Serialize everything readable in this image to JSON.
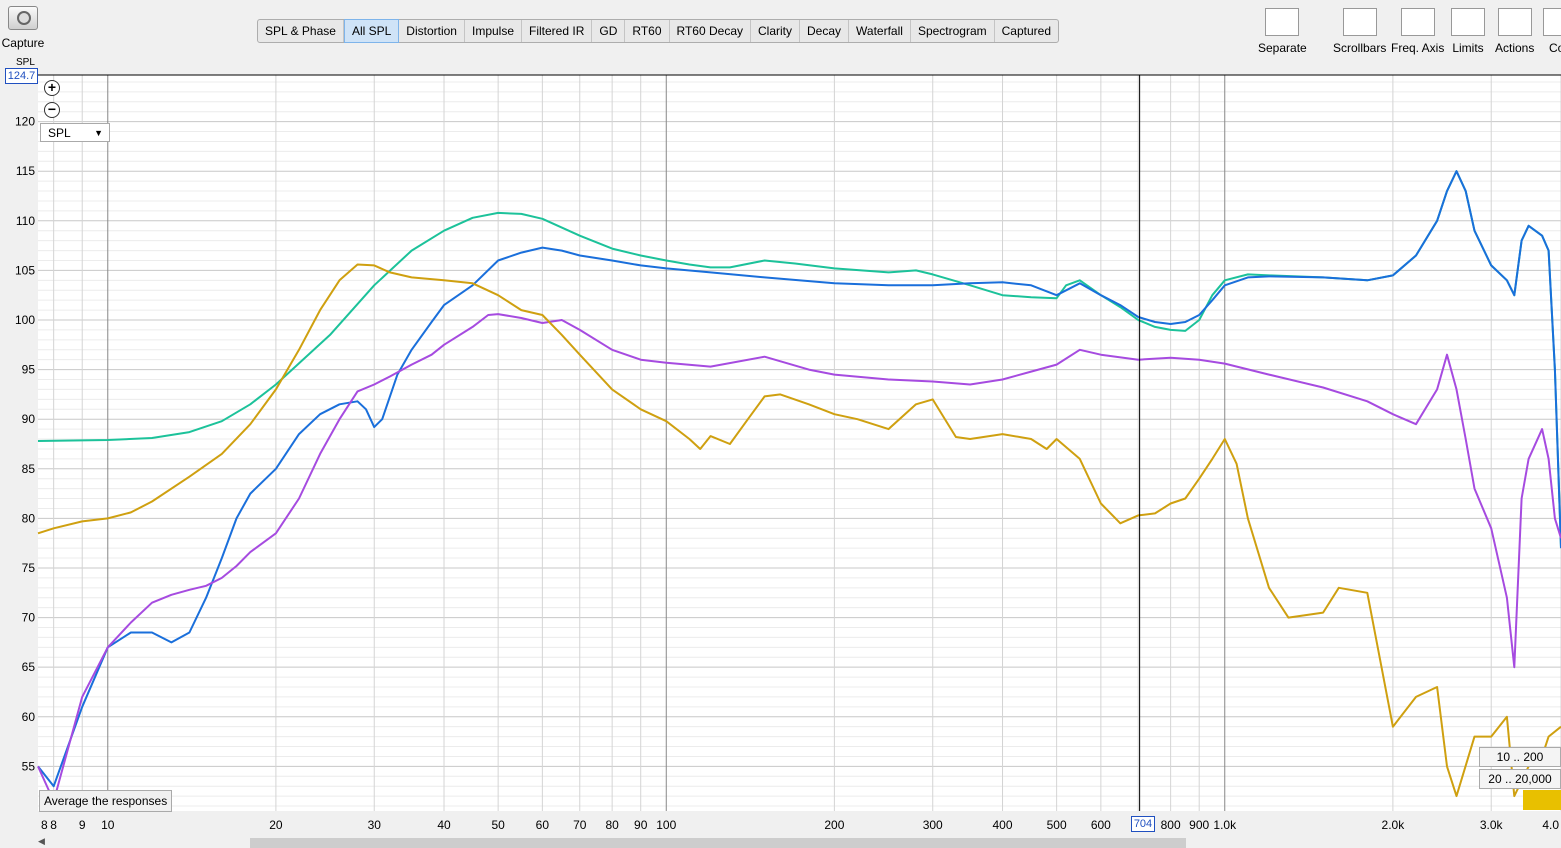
{
  "toolbar": {
    "capture_label": "Capture",
    "tabs": [
      "SPL & Phase",
      "All SPL",
      "Distortion",
      "Impulse",
      "Filtered IR",
      "GD",
      "RT60",
      "RT60 Decay",
      "Clarity",
      "Decay",
      "Waterfall",
      "Spectrogram",
      "Captured"
    ],
    "active_tab": "All SPL",
    "right_tools": [
      "Separate",
      "Scrollbars",
      "Freq. Axis",
      "Limits",
      "Actions",
      "Con"
    ]
  },
  "plot": {
    "axis_title": "SPL",
    "max_readout": "124.7",
    "cursor_freq": "704",
    "dropdown_value": "SPL",
    "avg_button": "Average the responses",
    "range_buttons": [
      "10 .. 200",
      "20 .. 20,000"
    ]
  },
  "chart_data": {
    "type": "line",
    "xscale": "log",
    "xlim": [
      7.5,
      4000
    ],
    "ylim": [
      50.5,
      124.7
    ],
    "x_ticks": [
      "8",
      "8",
      "9",
      "10",
      "20",
      "30",
      "40",
      "50",
      "60",
      "70",
      "80",
      "90",
      "100",
      "200",
      "300",
      "400",
      "500",
      "600",
      "704",
      "800",
      "900",
      "1.0k",
      "2.0k",
      "3.0k",
      "4.0"
    ],
    "y_ticks": [
      "55",
      "60",
      "65",
      "70",
      "75",
      "80",
      "85",
      "90",
      "95",
      "100",
      "105",
      "110",
      "115",
      "120"
    ],
    "cursor_x": 704,
    "series": [
      {
        "color": "#1cc29a",
        "points": [
          [
            7.5,
            87.8
          ],
          [
            10,
            87.9
          ],
          [
            12,
            88.1
          ],
          [
            14,
            88.7
          ],
          [
            16,
            89.8
          ],
          [
            18,
            91.5
          ],
          [
            20,
            93.5
          ],
          [
            25,
            98.5
          ],
          [
            30,
            103.5
          ],
          [
            35,
            107
          ],
          [
            40,
            109
          ],
          [
            45,
            110.3
          ],
          [
            50,
            110.8
          ],
          [
            55,
            110.7
          ],
          [
            60,
            110.2
          ],
          [
            70,
            108.5
          ],
          [
            80,
            107.2
          ],
          [
            90,
            106.5
          ],
          [
            100,
            106
          ],
          [
            110,
            105.6
          ],
          [
            120,
            105.3
          ],
          [
            130,
            105.3
          ],
          [
            150,
            106
          ],
          [
            170,
            105.7
          ],
          [
            200,
            105.2
          ],
          [
            250,
            104.8
          ],
          [
            280,
            105
          ],
          [
            300,
            104.6
          ],
          [
            350,
            103.5
          ],
          [
            400,
            102.5
          ],
          [
            450,
            102.3
          ],
          [
            500,
            102.2
          ],
          [
            520,
            103.5
          ],
          [
            550,
            104
          ],
          [
            600,
            102.5
          ],
          [
            650,
            101.3
          ],
          [
            700,
            100
          ],
          [
            750,
            99.3
          ],
          [
            800,
            99
          ],
          [
            850,
            98.9
          ],
          [
            900,
            100
          ],
          [
            950,
            102.5
          ],
          [
            1000,
            104
          ],
          [
            1100,
            104.6
          ],
          [
            1200,
            104.5
          ],
          [
            1500,
            104.3
          ],
          [
            1800,
            104
          ],
          [
            2000,
            104.5
          ],
          [
            2200,
            106.5
          ],
          [
            2400,
            110
          ],
          [
            2500,
            113
          ],
          [
            2600,
            115
          ],
          [
            2700,
            113
          ],
          [
            2800,
            109
          ],
          [
            3000,
            105.5
          ],
          [
            3200,
            104
          ],
          [
            3300,
            102.5
          ],
          [
            3400,
            108
          ],
          [
            3500,
            109.5
          ],
          [
            3700,
            108.5
          ],
          [
            3800,
            107
          ],
          [
            3900,
            95
          ],
          [
            4000,
            77
          ]
        ]
      },
      {
        "color": "#1a6fdb",
        "points": [
          [
            7.5,
            55
          ],
          [
            8,
            53
          ],
          [
            9,
            61
          ],
          [
            10,
            67
          ],
          [
            11,
            68.5
          ],
          [
            12,
            68.5
          ],
          [
            13,
            67.5
          ],
          [
            14,
            68.5
          ],
          [
            15,
            72
          ],
          [
            16,
            76
          ],
          [
            17,
            80
          ],
          [
            18,
            82.5
          ],
          [
            20,
            85
          ],
          [
            22,
            88.5
          ],
          [
            24,
            90.5
          ],
          [
            26,
            91.5
          ],
          [
            28,
            91.8
          ],
          [
            29,
            91
          ],
          [
            30,
            89.2
          ],
          [
            31,
            90
          ],
          [
            33,
            94.5
          ],
          [
            35,
            97
          ],
          [
            38,
            99.8
          ],
          [
            40,
            101.5
          ],
          [
            45,
            103.5
          ],
          [
            50,
            106
          ],
          [
            55,
            106.8
          ],
          [
            60,
            107.3
          ],
          [
            65,
            107
          ],
          [
            70,
            106.5
          ],
          [
            80,
            106
          ],
          [
            90,
            105.5
          ],
          [
            100,
            105.2
          ],
          [
            120,
            104.8
          ],
          [
            150,
            104.3
          ],
          [
            200,
            103.7
          ],
          [
            250,
            103.5
          ],
          [
            300,
            103.5
          ],
          [
            350,
            103.7
          ],
          [
            400,
            103.8
          ],
          [
            450,
            103.5
          ],
          [
            500,
            102.5
          ],
          [
            550,
            103.7
          ],
          [
            600,
            102.5
          ],
          [
            650,
            101.5
          ],
          [
            700,
            100.3
          ],
          [
            750,
            99.8
          ],
          [
            800,
            99.6
          ],
          [
            850,
            99.8
          ],
          [
            900,
            100.5
          ],
          [
            950,
            102
          ],
          [
            1000,
            103.5
          ],
          [
            1100,
            104.3
          ],
          [
            1200,
            104.4
          ],
          [
            1500,
            104.3
          ],
          [
            1800,
            104
          ],
          [
            2000,
            104.5
          ],
          [
            2200,
            106.5
          ],
          [
            2400,
            110
          ],
          [
            2500,
            113
          ],
          [
            2600,
            115
          ],
          [
            2700,
            113
          ],
          [
            2800,
            109
          ],
          [
            3000,
            105.5
          ],
          [
            3200,
            104
          ],
          [
            3300,
            102.5
          ],
          [
            3400,
            108
          ],
          [
            3500,
            109.5
          ],
          [
            3700,
            108.5
          ],
          [
            3800,
            107
          ],
          [
            3900,
            95
          ],
          [
            4000,
            77
          ]
        ]
      },
      {
        "color": "#a64be0",
        "points": [
          [
            7.5,
            55
          ],
          [
            8,
            51.5
          ],
          [
            9,
            62
          ],
          [
            10,
            67
          ],
          [
            11,
            69.5
          ],
          [
            12,
            71.5
          ],
          [
            13,
            72.3
          ],
          [
            14,
            72.8
          ],
          [
            15,
            73.2
          ],
          [
            16,
            74
          ],
          [
            17,
            75.2
          ],
          [
            18,
            76.6
          ],
          [
            20,
            78.5
          ],
          [
            22,
            82
          ],
          [
            24,
            86.5
          ],
          [
            26,
            90
          ],
          [
            28,
            92.8
          ],
          [
            30,
            93.5
          ],
          [
            32,
            94.3
          ],
          [
            35,
            95.5
          ],
          [
            38,
            96.5
          ],
          [
            40,
            97.5
          ],
          [
            45,
            99.3
          ],
          [
            48,
            100.5
          ],
          [
            50,
            100.6
          ],
          [
            55,
            100.2
          ],
          [
            60,
            99.7
          ],
          [
            65,
            100
          ],
          [
            70,
            99
          ],
          [
            80,
            97
          ],
          [
            90,
            96
          ],
          [
            100,
            95.7
          ],
          [
            120,
            95.3
          ],
          [
            150,
            96.3
          ],
          [
            180,
            95
          ],
          [
            200,
            94.5
          ],
          [
            250,
            94
          ],
          [
            300,
            93.8
          ],
          [
            350,
            93.5
          ],
          [
            400,
            94
          ],
          [
            450,
            94.8
          ],
          [
            500,
            95.5
          ],
          [
            550,
            97
          ],
          [
            600,
            96.5
          ],
          [
            700,
            96
          ],
          [
            800,
            96.2
          ],
          [
            900,
            96
          ],
          [
            1000,
            95.6
          ],
          [
            1200,
            94.5
          ],
          [
            1500,
            93.2
          ],
          [
            1800,
            91.8
          ],
          [
            2000,
            90.5
          ],
          [
            2200,
            89.5
          ],
          [
            2400,
            93
          ],
          [
            2500,
            96.5
          ],
          [
            2600,
            93
          ],
          [
            2700,
            88
          ],
          [
            2800,
            83
          ],
          [
            3000,
            79
          ],
          [
            3200,
            72
          ],
          [
            3300,
            65
          ],
          [
            3400,
            82
          ],
          [
            3500,
            86
          ],
          [
            3700,
            89
          ],
          [
            3800,
            86
          ],
          [
            3900,
            80
          ],
          [
            4000,
            78
          ]
        ]
      },
      {
        "color": "#cfa010",
        "points": [
          [
            7.5,
            78.5
          ],
          [
            8,
            79
          ],
          [
            9,
            79.7
          ],
          [
            10,
            80
          ],
          [
            11,
            80.6
          ],
          [
            12,
            81.7
          ],
          [
            14,
            84.2
          ],
          [
            16,
            86.5
          ],
          [
            18,
            89.5
          ],
          [
            20,
            93
          ],
          [
            22,
            97
          ],
          [
            24,
            101
          ],
          [
            26,
            104
          ],
          [
            28,
            105.6
          ],
          [
            30,
            105.5
          ],
          [
            32,
            104.8
          ],
          [
            35,
            104.3
          ],
          [
            40,
            104
          ],
          [
            45,
            103.7
          ],
          [
            50,
            102.5
          ],
          [
            55,
            101
          ],
          [
            60,
            100.5
          ],
          [
            65,
            98.5
          ],
          [
            70,
            96.5
          ],
          [
            80,
            93
          ],
          [
            90,
            91
          ],
          [
            100,
            89.8
          ],
          [
            110,
            88
          ],
          [
            115,
            87
          ],
          [
            120,
            88.3
          ],
          [
            130,
            87.5
          ],
          [
            140,
            90
          ],
          [
            150,
            92.3
          ],
          [
            160,
            92.5
          ],
          [
            180,
            91.5
          ],
          [
            200,
            90.5
          ],
          [
            220,
            90
          ],
          [
            250,
            89
          ],
          [
            280,
            91.5
          ],
          [
            300,
            92
          ],
          [
            330,
            88.2
          ],
          [
            350,
            88
          ],
          [
            400,
            88.5
          ],
          [
            450,
            88
          ],
          [
            480,
            87
          ],
          [
            500,
            88
          ],
          [
            550,
            86
          ],
          [
            600,
            81.5
          ],
          [
            650,
            79.5
          ],
          [
            700,
            80.3
          ],
          [
            750,
            80.5
          ],
          [
            800,
            81.5
          ],
          [
            850,
            82
          ],
          [
            900,
            84
          ],
          [
            950,
            86
          ],
          [
            1000,
            88
          ],
          [
            1050,
            85.5
          ],
          [
            1100,
            80
          ],
          [
            1200,
            73
          ],
          [
            1300,
            70
          ],
          [
            1500,
            70.5
          ],
          [
            1600,
            73
          ],
          [
            1800,
            72.5
          ],
          [
            2000,
            59
          ],
          [
            2200,
            62
          ],
          [
            2400,
            63
          ],
          [
            2500,
            55
          ],
          [
            2600,
            52
          ],
          [
            2800,
            58
          ],
          [
            3000,
            58
          ],
          [
            3200,
            60
          ],
          [
            3300,
            52
          ],
          [
            3500,
            55
          ],
          [
            3700,
            56
          ],
          [
            3800,
            58
          ],
          [
            4000,
            59
          ]
        ]
      }
    ]
  }
}
